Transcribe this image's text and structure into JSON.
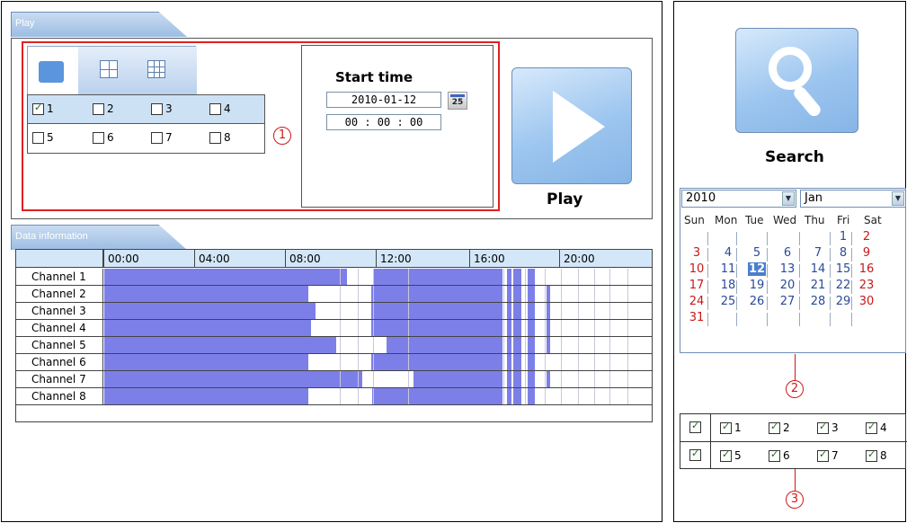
{
  "play_panel": {
    "tab_label": "Play",
    "channels": [
      {
        "label": "1",
        "checked": true
      },
      {
        "label": "2",
        "checked": false
      },
      {
        "label": "3",
        "checked": false
      },
      {
        "label": "4",
        "checked": false
      },
      {
        "label": "5",
        "checked": false
      },
      {
        "label": "6",
        "checked": false
      },
      {
        "label": "7",
        "checked": false
      },
      {
        "label": "8",
        "checked": false
      }
    ],
    "marker": "1",
    "start_time_label": "Start time",
    "date_value": "2010-01-12",
    "time_value": "00 : 00 : 00",
    "calendar_button": "25",
    "play_label": "Play"
  },
  "data_info": {
    "tab_label": "Data information",
    "ticks": [
      "00:00",
      "04:00",
      "08:00",
      "12:00",
      "16:00",
      "20:00"
    ],
    "channels": [
      "Channel 1",
      "Channel 2",
      "Channel 3",
      "Channel 4",
      "Channel 5",
      "Channel 6",
      "Channel 7",
      "Channel 8"
    ]
  },
  "search": {
    "label": "Search"
  },
  "calendar": {
    "year": "2010",
    "month": "Jan",
    "weekdays": [
      "Sun",
      "Mon",
      "Tue",
      "Wed",
      "Thu",
      "Fri",
      "Sat"
    ],
    "days": [
      "1",
      "2",
      "3",
      "4",
      "5",
      "6",
      "7",
      "8",
      "9",
      "10",
      "11",
      "12",
      "13",
      "14",
      "15",
      "16",
      "17",
      "18",
      "19",
      "20",
      "21",
      "22",
      "23",
      "24",
      "25",
      "26",
      "27",
      "28",
      "29",
      "30",
      "31"
    ],
    "selected_day": "12",
    "marker": "2"
  },
  "channel_select": {
    "rows": [
      [
        "1",
        "2",
        "3",
        "4"
      ],
      [
        "5",
        "6",
        "7",
        "8"
      ]
    ],
    "marker": "3"
  },
  "colors": {
    "recording": "#7d7fe8",
    "header_blue": "#d3e7f8",
    "highlight_red": "#e02020"
  }
}
